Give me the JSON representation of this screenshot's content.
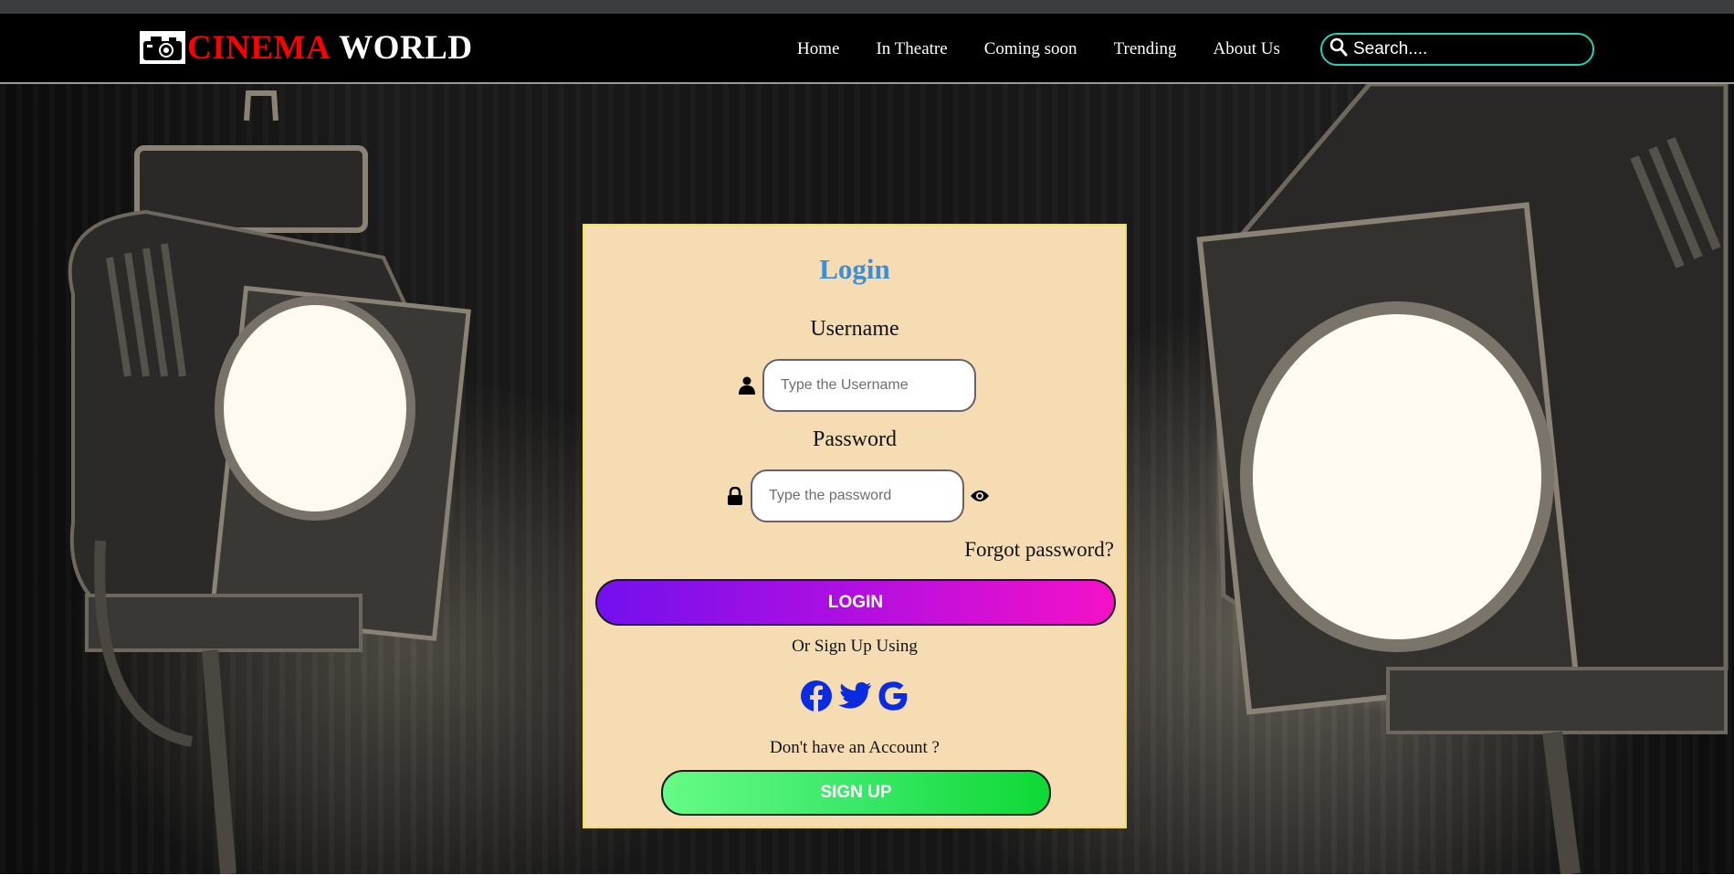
{
  "brand": {
    "word1": "CINEMA",
    "word2": "WORLD",
    "logo_icon": "camera-icon",
    "word1_color": "#ff0000"
  },
  "nav": {
    "items": [
      "Home",
      "In Theatre",
      "Coming soon",
      "Trending",
      "About Us"
    ]
  },
  "search": {
    "placeholder": "Search....",
    "icon": "search-icon",
    "border_color": "#20d3b8"
  },
  "login_form": {
    "title": "Login",
    "username_label": "Username",
    "username_placeholder": "Type the Username",
    "password_label": "Password",
    "password_placeholder": "Type the password",
    "forgot_label": "Forgot password?",
    "login_button": "LOGIN",
    "or_text": "Or Sign Up Using",
    "social": [
      "facebook-icon",
      "twitter-icon",
      "google-icon"
    ],
    "no_account_text": "Don't have an Account ?",
    "signup_button": "SIGN UP"
  },
  "colors": {
    "title": "#3b8fd8",
    "card_bg": "#f5dcb3",
    "social": "#0a2be0"
  }
}
